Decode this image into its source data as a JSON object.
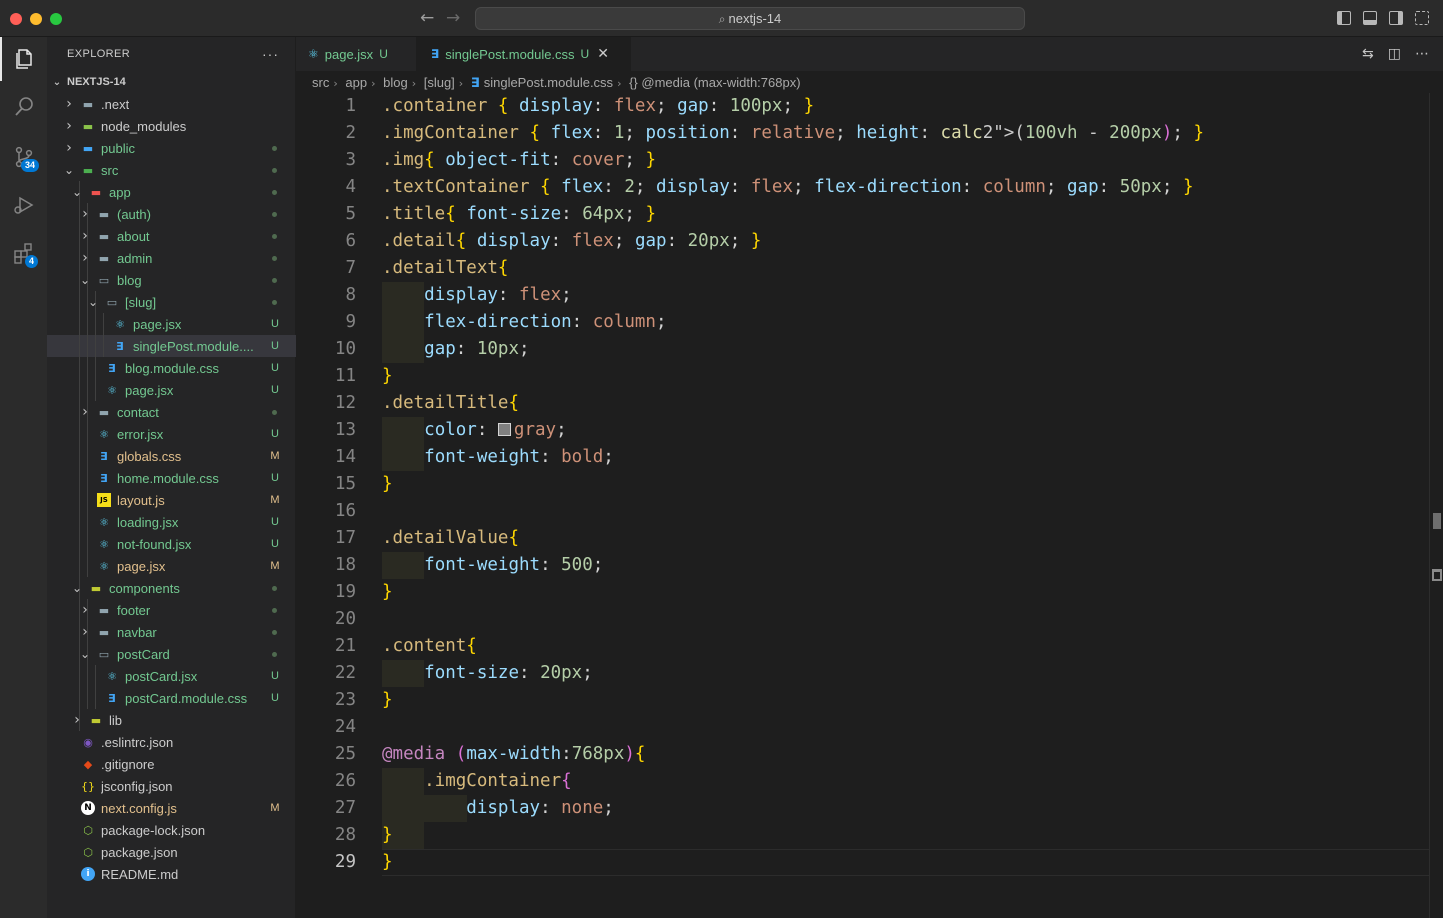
{
  "window": {
    "search_text": "nextjs-14",
    "back_icon": "arrow-left-icon",
    "forward_icon": "arrow-right-icon"
  },
  "activity_bar": {
    "source_control_badge": "34",
    "extensions_badge": "4"
  },
  "sidebar": {
    "title": "EXPLORER",
    "more_label": "···",
    "project": "NEXTJS-14",
    "tree": [
      {
        "name": ".next",
        "depth": 1,
        "type": "folder",
        "expanded": false,
        "icon": "next-folder-icon",
        "status": ""
      },
      {
        "name": "node_modules",
        "depth": 1,
        "type": "folder",
        "expanded": false,
        "icon": "node-modules-folder-icon",
        "status": ""
      },
      {
        "name": "public",
        "depth": 1,
        "type": "folder",
        "expanded": false,
        "icon": "public-folder-icon",
        "status": "dot"
      },
      {
        "name": "src",
        "depth": 1,
        "type": "folder",
        "expanded": true,
        "icon": "src-folder-icon",
        "status": "dot"
      },
      {
        "name": "app",
        "depth": 2,
        "type": "folder",
        "expanded": true,
        "icon": "app-folder-icon",
        "status": "dot"
      },
      {
        "name": "(auth)",
        "depth": 3,
        "type": "folder",
        "expanded": false,
        "icon": "folder-icon",
        "status": "dot"
      },
      {
        "name": "about",
        "depth": 3,
        "type": "folder",
        "expanded": false,
        "icon": "folder-icon",
        "status": "dot"
      },
      {
        "name": "admin",
        "depth": 3,
        "type": "folder",
        "expanded": false,
        "icon": "admin-folder-icon",
        "status": "dot"
      },
      {
        "name": "blog",
        "depth": 3,
        "type": "folder",
        "expanded": true,
        "icon": "folder-open-icon",
        "status": "dot"
      },
      {
        "name": "[slug]",
        "depth": 4,
        "type": "folder",
        "expanded": true,
        "icon": "folder-open-icon",
        "status": "dot"
      },
      {
        "name": "page.jsx",
        "depth": 5,
        "type": "react",
        "icon": "react-icon",
        "status": "U"
      },
      {
        "name": "singlePost.module....",
        "depth": 5,
        "type": "css",
        "icon": "css-icon",
        "status": "U",
        "selected": true
      },
      {
        "name": "blog.module.css",
        "depth": 4,
        "type": "css",
        "icon": "css-icon",
        "status": "U"
      },
      {
        "name": "page.jsx",
        "depth": 4,
        "type": "react",
        "icon": "react-icon",
        "status": "U"
      },
      {
        "name": "contact",
        "depth": 3,
        "type": "folder",
        "expanded": false,
        "icon": "folder-icon",
        "status": "dot"
      },
      {
        "name": "error.jsx",
        "depth": 3,
        "type": "react",
        "icon": "react-icon",
        "status": "U"
      },
      {
        "name": "globals.css",
        "depth": 3,
        "type": "css",
        "icon": "css-icon",
        "status": "M"
      },
      {
        "name": "home.module.css",
        "depth": 3,
        "type": "css",
        "icon": "css-icon",
        "status": "U"
      },
      {
        "name": "layout.js",
        "depth": 3,
        "type": "js",
        "icon": "js-icon",
        "status": "M"
      },
      {
        "name": "loading.jsx",
        "depth": 3,
        "type": "react",
        "icon": "react-icon",
        "status": "U"
      },
      {
        "name": "not-found.jsx",
        "depth": 3,
        "type": "react",
        "icon": "react-icon",
        "status": "U"
      },
      {
        "name": "page.jsx",
        "depth": 3,
        "type": "react",
        "icon": "react-icon",
        "status": "M"
      },
      {
        "name": "components",
        "depth": 2,
        "type": "folder",
        "expanded": true,
        "icon": "components-folder-icon",
        "status": "dot"
      },
      {
        "name": "footer",
        "depth": 3,
        "type": "folder",
        "expanded": false,
        "icon": "folder-icon",
        "status": "dot"
      },
      {
        "name": "navbar",
        "depth": 3,
        "type": "folder",
        "expanded": false,
        "icon": "folder-icon",
        "status": "dot"
      },
      {
        "name": "postCard",
        "depth": 3,
        "type": "folder",
        "expanded": true,
        "icon": "folder-open-icon",
        "status": "dot"
      },
      {
        "name": "postCard.jsx",
        "depth": 4,
        "type": "react",
        "icon": "react-icon",
        "status": "U"
      },
      {
        "name": "postCard.module.css",
        "depth": 4,
        "type": "css",
        "icon": "css-icon",
        "status": "U"
      },
      {
        "name": "lib",
        "depth": 2,
        "type": "folder",
        "expanded": false,
        "icon": "lib-folder-icon",
        "status": ""
      },
      {
        "name": ".eslintrc.json",
        "depth": 1,
        "type": "eslint",
        "icon": "eslint-icon",
        "status": ""
      },
      {
        "name": ".gitignore",
        "depth": 1,
        "type": "git",
        "icon": "git-icon",
        "status": ""
      },
      {
        "name": "jsconfig.json",
        "depth": 1,
        "type": "jsconfig",
        "icon": "jsconfig-icon",
        "status": ""
      },
      {
        "name": "next.config.js",
        "depth": 1,
        "type": "next",
        "icon": "next-icon",
        "status": "M"
      },
      {
        "name": "package-lock.json",
        "depth": 1,
        "type": "npm",
        "icon": "npm-icon",
        "status": ""
      },
      {
        "name": "package.json",
        "depth": 1,
        "type": "npm",
        "icon": "npm-icon",
        "status": ""
      },
      {
        "name": "README.md",
        "depth": 1,
        "type": "info",
        "icon": "info-icon",
        "status": ""
      }
    ]
  },
  "tabs": [
    {
      "label": "page.jsx",
      "status": "U",
      "icon": "react-icon",
      "active": false
    },
    {
      "label": "singlePost.module.css",
      "status": "U",
      "icon": "css-icon",
      "active": true,
      "close": "✕"
    }
  ],
  "breadcrumb": {
    "parts": [
      "src",
      "app",
      "blog",
      "[slug]"
    ],
    "file": "singlePost.module.css",
    "symbol": "{} @media (max-width:768px)"
  },
  "code_lines": [
    ".container { display: flex; gap: 100px; }",
    ".imgContainer { flex: 1; position: relative; height: calc(100vh - 200px); }",
    ".img{ object-fit: cover; }",
    ".textContainer { flex: 2; display: flex; flex-direction: column; gap: 50px; }",
    ".title{ font-size: 64px; }",
    ".detail{ display: flex; gap: 20px; }",
    ".detailText{",
    "    display: flex;",
    "    flex-direction: column;",
    "    gap: 10px;",
    "}",
    ".detailTitle{",
    "    color: gray;",
    "    font-weight: bold;",
    "}",
    "",
    ".detailValue{",
    "    font-weight: 500;",
    "}",
    "",
    ".content{",
    "    font-size: 20px;",
    "}",
    "",
    "@media (max-width:768px){",
    "    .imgContainer{",
    "        display: none;",
    "    }",
    "}"
  ],
  "current_line": 29,
  "colors": {
    "untracked": "#73c991",
    "modified": "#e2c08d",
    "selector": "#d7ba7d",
    "property": "#9cdcfe",
    "value": "#ce9178",
    "number": "#b5cea8"
  }
}
